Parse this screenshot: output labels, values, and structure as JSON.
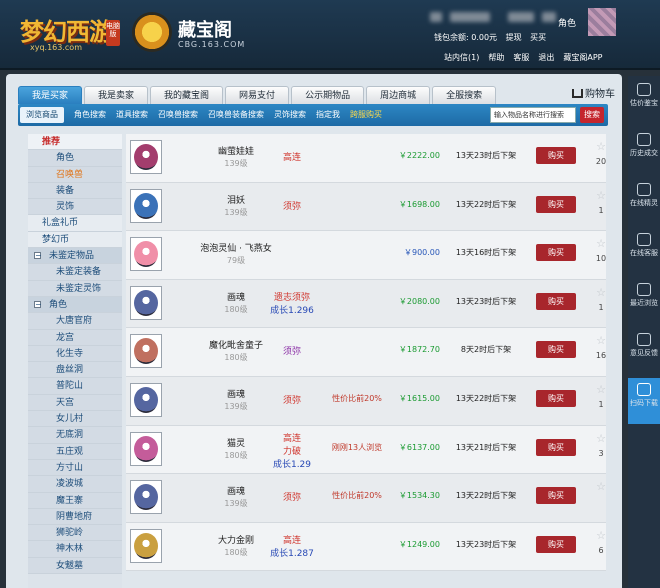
{
  "header": {
    "game_logo_text": "梦幻西游",
    "game_logo_url": "xyq.163.com",
    "game_logo_badge": "电脑版",
    "cbg_name": "藏宝阁",
    "cbg_domain": "CBG.163.COM",
    "role_suffix": "角色",
    "wallet": "钱包余额: 0.00元",
    "withdraw": "提现",
    "buy_label": "买买",
    "links": [
      "站内信(1)",
      "帮助",
      "客服",
      "退出",
      "藏宝阁APP"
    ]
  },
  "tabs": [
    {
      "label": "我是买家",
      "active": true
    },
    {
      "label": "我是卖家"
    },
    {
      "label": "我的藏宝阁"
    },
    {
      "label": "网易支付"
    },
    {
      "label": "公示期物品"
    },
    {
      "label": "周边商城"
    },
    {
      "label": "全服搜索"
    }
  ],
  "cart_label": "购物车",
  "subnav": [
    {
      "label": "浏览商品",
      "active": true
    },
    {
      "label": "角色搜索"
    },
    {
      "label": "道具搜索"
    },
    {
      "label": "召唤兽搜索"
    },
    {
      "label": "召唤兽装备搜索"
    },
    {
      "label": "灵饰搜索"
    },
    {
      "label": "指定我"
    },
    {
      "label": "跨服购买",
      "hot": true
    }
  ],
  "search": {
    "placeholder": "输入物品名称进行搜索",
    "button": "搜索"
  },
  "sidebar": [
    {
      "label": "推荐",
      "kind": "top red"
    },
    {
      "label": "角色",
      "kind": "l2"
    },
    {
      "label": "召唤兽",
      "kind": "l2 hl"
    },
    {
      "label": "装备",
      "kind": "l2"
    },
    {
      "label": "灵饰",
      "kind": "l2"
    },
    {
      "label": "礼盒礼币",
      "kind": "top"
    },
    {
      "label": "梦幻币",
      "kind": "top"
    },
    {
      "label": "未鉴定物品",
      "kind": "grp"
    },
    {
      "label": "未鉴定装备",
      "kind": "l2"
    },
    {
      "label": "未鉴定灵饰",
      "kind": "l2"
    },
    {
      "label": "角色",
      "kind": "grp"
    },
    {
      "label": "大唐官府",
      "kind": "l2"
    },
    {
      "label": "龙宫",
      "kind": "l2"
    },
    {
      "label": "化生寺",
      "kind": "l2"
    },
    {
      "label": "盘丝洞",
      "kind": "l2"
    },
    {
      "label": "普陀山",
      "kind": "l2"
    },
    {
      "label": "天宫",
      "kind": "l2"
    },
    {
      "label": "女儿村",
      "kind": "l2"
    },
    {
      "label": "无底洞",
      "kind": "l2"
    },
    {
      "label": "五庄观",
      "kind": "l2"
    },
    {
      "label": "方寸山",
      "kind": "l2"
    },
    {
      "label": "凌波城",
      "kind": "l2"
    },
    {
      "label": "魔王寨",
      "kind": "l2"
    },
    {
      "label": "阴曹地府",
      "kind": "l2"
    },
    {
      "label": "狮驼岭",
      "kind": "l2"
    },
    {
      "label": "神木林",
      "kind": "l2"
    },
    {
      "label": "女魃墓",
      "kind": "l2"
    }
  ],
  "items": [
    {
      "name": "幽萤娃娃",
      "level": "139级",
      "traits": [
        {
          "t": "高连",
          "c": "red"
        }
      ],
      "note": "",
      "price": "￥2222.00",
      "price_color": "green",
      "time": "13天23时后下架",
      "fav": "20",
      "color": "#a33d6d"
    },
    {
      "name": "泪妖",
      "level": "139级",
      "traits": [
        {
          "t": "须弥",
          "c": "red"
        }
      ],
      "note": "",
      "price": "￥1698.00",
      "price_color": "green",
      "time": "13天22时后下架",
      "fav": "1",
      "color": "#3b72b8"
    },
    {
      "name": "泡泡灵仙 · 飞燕女",
      "level": "79级",
      "traits": [],
      "note": "",
      "price": "￥900.00",
      "price_color": "blue",
      "time": "13天16时后下架",
      "fav": "10",
      "color": "#f08fa8"
    },
    {
      "name": "画魂",
      "level": "180级",
      "traits": [
        {
          "t": "遗志须弥",
          "c": "red"
        },
        {
          "t": "成长1.296",
          "c": "blue"
        }
      ],
      "note": "",
      "price": "￥2080.00",
      "price_color": "green",
      "time": "13天23时后下架",
      "fav": "1",
      "color": "#5566a0"
    },
    {
      "name": "魔化毗舍童子",
      "level": "180级",
      "traits": [
        {
          "t": "须弥",
          "c": "purple"
        }
      ],
      "note": "",
      "price": "￥1872.70",
      "price_color": "green",
      "time": "8天2时后下架",
      "fav": "16",
      "color": "#c07060"
    },
    {
      "name": "画魂",
      "level": "139级",
      "traits": [
        {
          "t": "须弥",
          "c": "red"
        }
      ],
      "note": "性价比前20%",
      "price": "￥1615.00",
      "price_color": "green",
      "time": "13天22时后下架",
      "fav": "1",
      "color": "#5566a0"
    },
    {
      "name": "猫灵",
      "level": "180级",
      "traits": [
        {
          "t": "高连",
          "c": "red"
        },
        {
          "t": "力破",
          "c": "red"
        },
        {
          "t": "成长1.29",
          "c": "blue"
        }
      ],
      "note": "刚刚13人浏览",
      "price": "￥6137.00",
      "price_color": "green",
      "time": "13天21时后下架",
      "fav": "3",
      "color": "#c45c9a"
    },
    {
      "name": "画魂",
      "level": "139级",
      "traits": [
        {
          "t": "须弥",
          "c": "red"
        }
      ],
      "note": "性价比前20%",
      "price": "￥1534.30",
      "price_color": "green",
      "time": "13天22时后下架",
      "fav": "",
      "color": "#5566a0"
    },
    {
      "name": "大力金刚",
      "level": "180级",
      "traits": [
        {
          "t": "高连",
          "c": "red"
        },
        {
          "t": "成长1.287",
          "c": "blue"
        }
      ],
      "note": "",
      "price": "￥1249.00",
      "price_color": "green",
      "time": "13天23时后下架",
      "fav": "6",
      "color": "#caa040"
    }
  ],
  "buy_label_row": "购买",
  "rightbar": [
    {
      "label": "估价鉴宝"
    },
    {
      "label": "历史成交"
    },
    {
      "label": "在线精灵"
    },
    {
      "label": "在线客服"
    },
    {
      "label": "最近浏览"
    },
    {
      "label": "意见反馈"
    },
    {
      "label": "扫码下载",
      "active": true
    }
  ]
}
